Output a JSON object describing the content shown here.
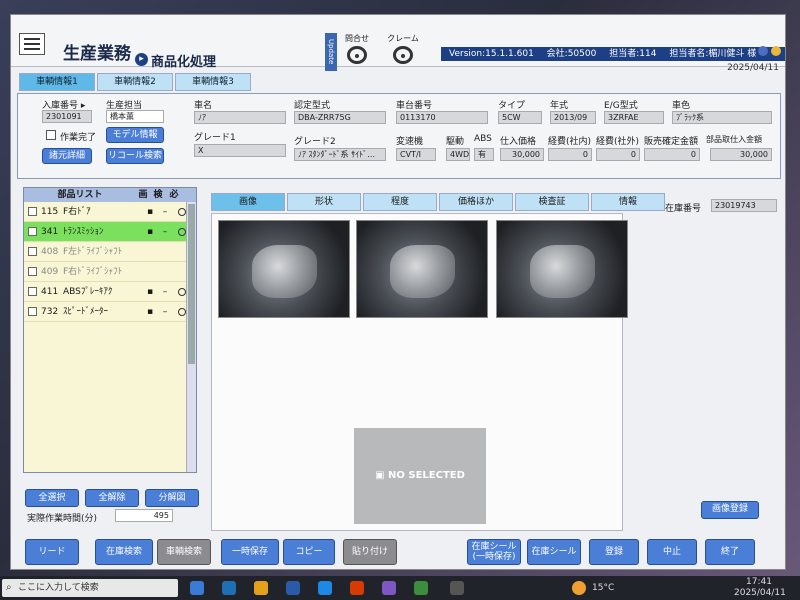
{
  "app": {
    "title": "生産業務",
    "subtitle": "商品化処理",
    "update_tag": "Update",
    "inquiry_label": "問合せ",
    "claim_label": "クレーム",
    "version": "Version:15.1.1.601",
    "company": "会社:50500",
    "staff_code": "担当者:114",
    "staff_name": "担当者名:楣川健斗 様",
    "date": "2025/04/11"
  },
  "top_tabs": [
    "車輌情報1",
    "車輌情報2",
    "車輌情報3"
  ],
  "vehicle_left": {
    "entry_no_label": "入庫番号 ▸",
    "entry_no": "2301091",
    "staff_label": "生産担当",
    "staff": "橋本薫",
    "work_done_label": "作業完了",
    "model_info_btn": "モデル情報",
    "spec_detail_btn": "諸元詳細",
    "recall_btn": "リコール検索"
  },
  "vehicle": {
    "name_label": "車名",
    "name": "ﾉｱ",
    "cert_label": "認定型式",
    "cert": "DBA-ZRR75G",
    "chassis_label": "車台番号",
    "chassis": "0113170",
    "type_label": "タイプ",
    "type": "5CW",
    "year_label": "年式",
    "year": "2013/09",
    "eg_label": "E/G型式",
    "eg": "3ZRFAE",
    "color_label": "車色",
    "color": "ﾌﾞﾗｯｸ系",
    "grade1_label": "グレード1",
    "grade1": "X",
    "grade2_label": "グレード2",
    "grade2": "ﾉｱ ｽﾀﾝﾀﾞｰﾄﾞ系 ｻｲﾄﾞ…",
    "trans_label": "変速機",
    "trans": "CVT/I",
    "drive_label": "駆動",
    "drive": "4WD",
    "abs_label": "ABS",
    "abs": "有",
    "purchase_label": "仕入価格",
    "purchase": "30,000",
    "cost_in_label": "経費(社内)",
    "cost_in": "0",
    "cost_out_label": "経費(社外)",
    "cost_out": "0",
    "sales_label": "販売確定金額",
    "sales": "0",
    "parts_total_label": "部品取仕入金額",
    "parts_total": "30,000"
  },
  "parts": {
    "header": [
      "部品リスト",
      "画",
      "検",
      "必"
    ],
    "rows": [
      {
        "no": "115",
        "name": "F右ﾄﾞｱ"
      },
      {
        "no": "341",
        "name": "ﾄﾗﾝｽﾐｯｼｮﾝ"
      },
      {
        "no": "408",
        "name": "F左ﾄﾞﾗｲﾌﾞｼｬﾌﾄ"
      },
      {
        "no": "409",
        "name": "F右ﾄﾞﾗｲﾌﾞｼｬﾌﾄ"
      },
      {
        "no": "411",
        "name": "ABSﾌﾟﾚｰｷｱｸ"
      },
      {
        "no": "732",
        "name": "ｽﾋﾟｰﾄﾞﾒｰﾀｰ"
      }
    ],
    "select_all": "全選択",
    "deselect_all": "全解除",
    "diagram": "分解図",
    "work_time_label": "実際作業時間(分)",
    "work_time": "495"
  },
  "main_tabs": [
    "画像",
    "形状",
    "程度",
    "価格ほか",
    "検査証",
    "情報"
  ],
  "stock": {
    "label": "在庫番号",
    "value": "23019743"
  },
  "no_selected": "NO SELECTED",
  "image_register": "画像登録",
  "bottom_buttons": {
    "read": "リード",
    "stock_search": "在庫検索",
    "vehicle_search": "車輌検索",
    "temp_save": "一時保存",
    "copy": "コピー",
    "paste": "貼り付け",
    "stock_seal_temp_1": "在庫シール",
    "stock_seal_temp_2": "(一時保存)",
    "stock_seal": "在庫シール",
    "register": "登録",
    "cancel": "中止",
    "exit": "終了"
  },
  "taskbar": {
    "search_placeholder": "ここに入力して検索",
    "temperature": "15°C",
    "time": "17:41",
    "date": "2025/04/11"
  }
}
